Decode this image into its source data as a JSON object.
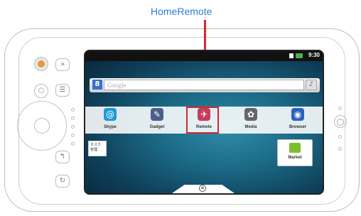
{
  "callout_label": "HomeRemote",
  "status": {
    "time": "9:30"
  },
  "search": {
    "badge": "8",
    "placeholder": "Google"
  },
  "apps": [
    {
      "label": "Skype",
      "icon": "skype-icon",
      "color": "#1e9ad6",
      "glyph": "@"
    },
    {
      "label": "Gadget",
      "icon": "gadget-icon",
      "color": "#4a5f8a",
      "glyph": "✎"
    },
    {
      "label": "Remote",
      "icon": "remote-icon",
      "color": "#c73d5a",
      "glyph": "✈"
    },
    {
      "label": "Media",
      "icon": "media-icon",
      "color": "#666",
      "glyph": "✿"
    },
    {
      "label": "Browser",
      "icon": "browser-icon",
      "color": "#2a62c2",
      "glyph": "◉"
    }
  ],
  "note": {
    "line1": "タスク",
    "line2": "管理"
  },
  "market": {
    "label": "Market"
  },
  "colors": {
    "accent_red": "#d9252c",
    "callout_blue": "#2c7fd0"
  }
}
